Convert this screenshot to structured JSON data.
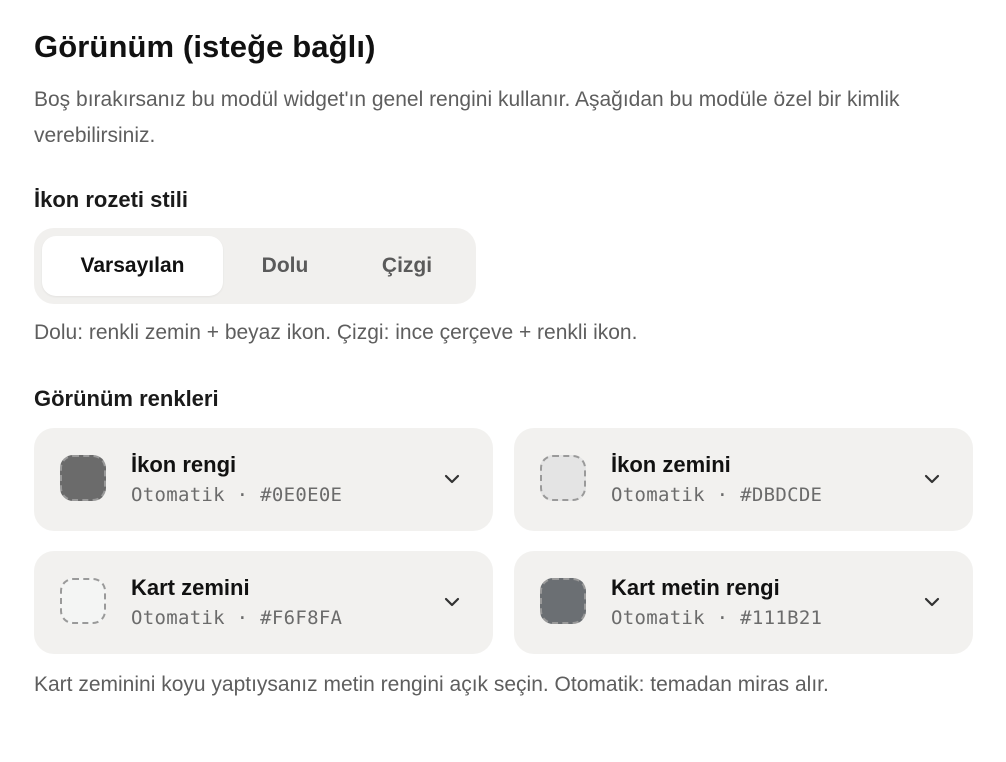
{
  "header": {
    "title": "Görünüm (isteğe bağlı)",
    "description": "Boş bırakırsanız bu modül widget'ın genel rengini kullanır. Aşağıdan bu modüle özel bir kimlik verebilirsiniz."
  },
  "badge_style": {
    "label": "İkon rozeti stili",
    "options": [
      "Varsayılan",
      "Dolu",
      "Çizgi"
    ],
    "selected": "Varsayılan",
    "hint": "Dolu: renkli zemin + beyaz ikon. Çizgi: ince çerçeve + renkli ikon."
  },
  "colors": {
    "label": "Görünüm renkleri",
    "items": [
      {
        "title": "İkon rengi",
        "value": "Otomatik · #0E0E0E",
        "swatch": "#6b6b6b"
      },
      {
        "title": "İkon zemini",
        "value": "Otomatik · #DBDCDE",
        "swatch": "#e4e4e4"
      },
      {
        "title": "Kart zemini",
        "value": "Otomatik · #F6F8FA",
        "swatch": "#f4f5f4"
      },
      {
        "title": "Kart metin rengi",
        "value": "Otomatik · #111B21",
        "swatch": "#6b6f73"
      }
    ],
    "hint": "Kart zeminini koyu yaptıysanız metin rengini açık seçin. Otomatik: temadan miras alır."
  },
  "icons": {
    "dropdown": "chevron-down-icon"
  }
}
